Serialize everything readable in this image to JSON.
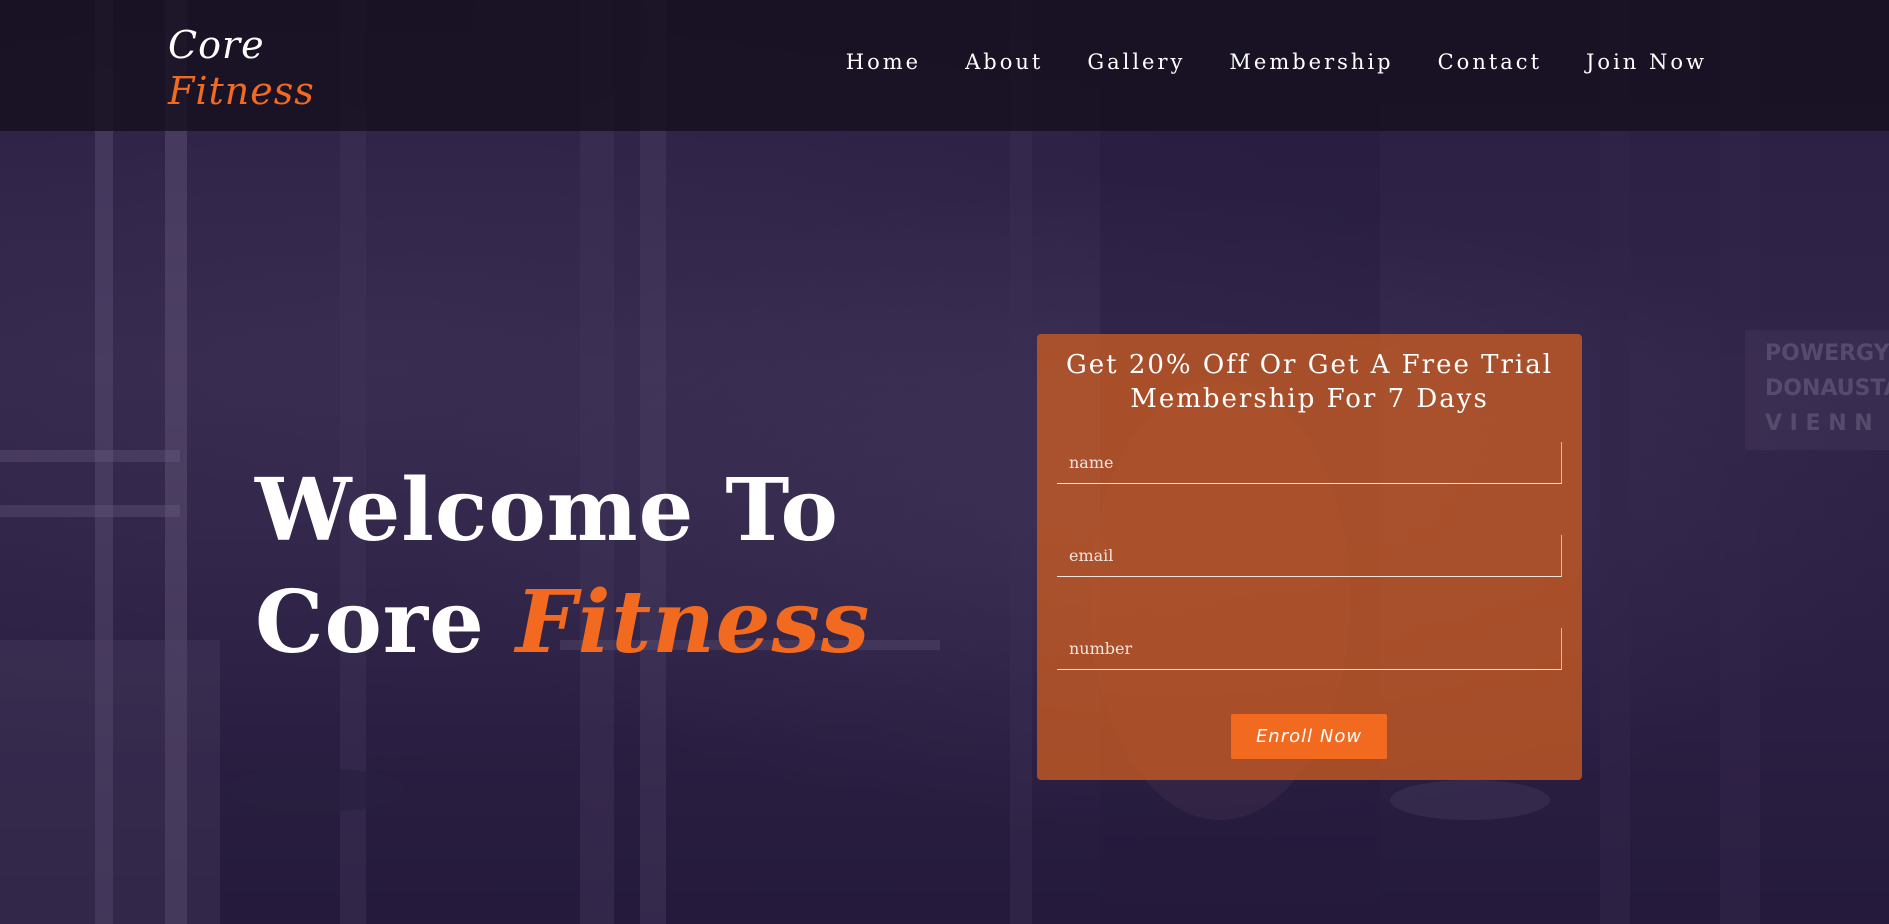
{
  "brand": {
    "line1": "Core",
    "line2": "Fitness"
  },
  "nav": {
    "items": [
      "Home",
      "About",
      "Gallery",
      "Membership",
      "Contact",
      "Join Now"
    ]
  },
  "hero": {
    "line1": "Welcome To",
    "line2_prefix": "Core",
    "line2_accent": "Fitness"
  },
  "offer": {
    "title_line1": "Get 20% Off Or Get A Free Trial",
    "title_line2": "Membership For 7 Days",
    "fields": {
      "name_placeholder": "name",
      "email_placeholder": "email",
      "number_placeholder": "number"
    },
    "submit_label": "Enroll Now"
  },
  "colors": {
    "accent": "#f26a1f",
    "header_bg": "#16101e",
    "overlay": "#2a1c46",
    "card_bg": "#d65f1e"
  }
}
